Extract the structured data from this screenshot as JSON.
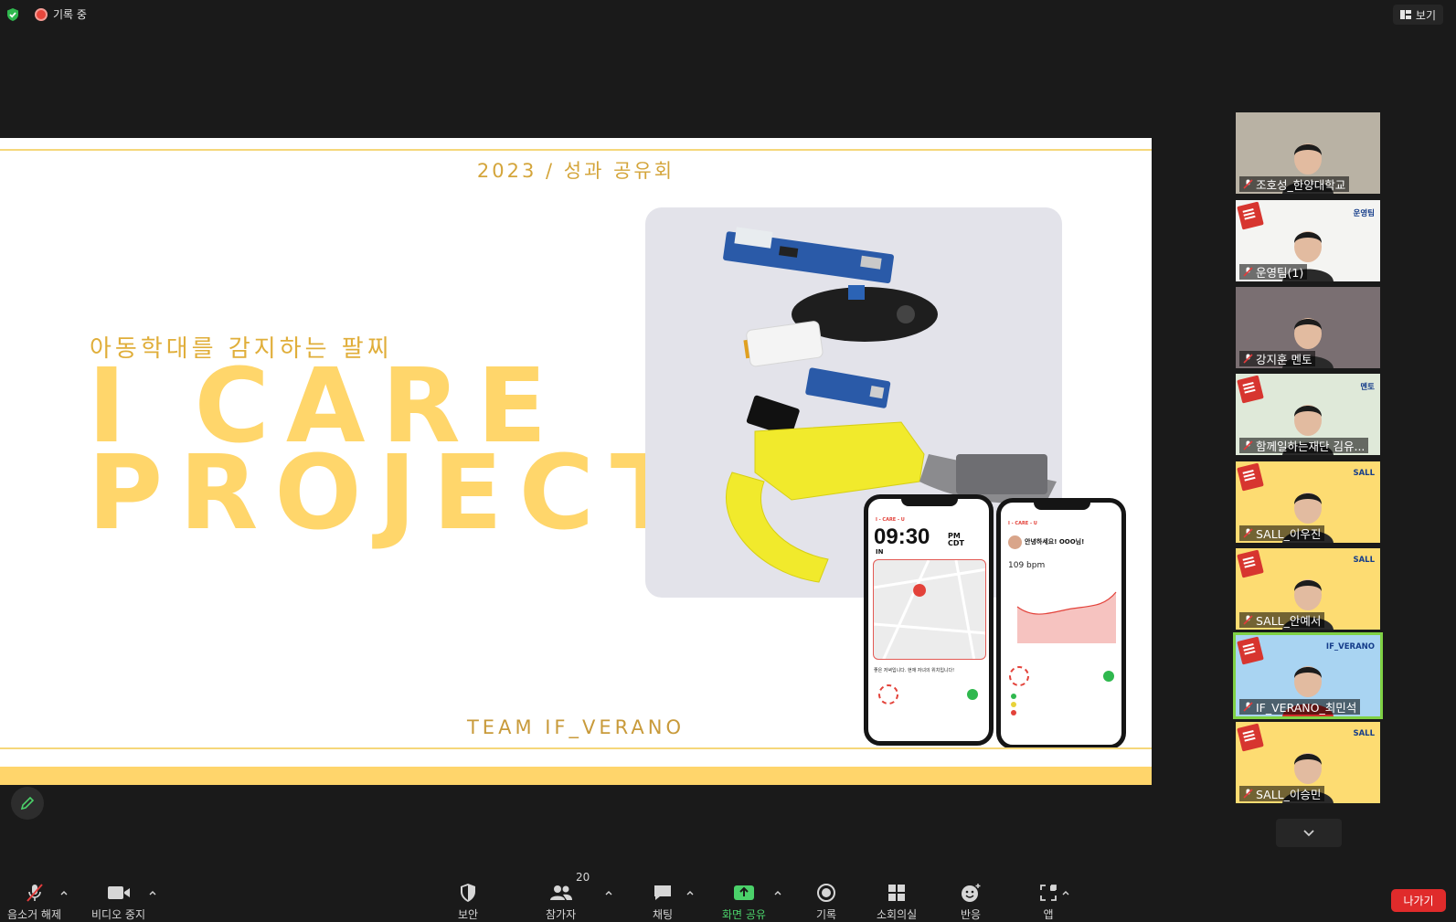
{
  "top_bar": {
    "recording_label": "기록 중",
    "view_label": "보기"
  },
  "slide": {
    "header": "2023 / 성과 공유회",
    "subtitle": "아동학대를 감지하는 팔찌",
    "title_line1": "I CARE",
    "title_line2": "PROJECT",
    "team": "TEAM IF_VERANO",
    "phone1": {
      "brand": "I - CARE - U",
      "time": "09:30",
      "ampm_top": "PM",
      "ampm_bottom": "CDT",
      "in_label": "IN",
      "message": "좋은 저녁입니다. 현재 자녀의 위치입니다!"
    },
    "phone2": {
      "brand": "I - CARE - U",
      "greeting": "안녕하세요! OOO님!",
      "bpm": "109 bpm"
    }
  },
  "participants": [
    {
      "name": "조호성_한양대학교",
      "tag": "",
      "bg": "#b9b2a4"
    },
    {
      "name": "운영팀(1)",
      "tag": "운영팀",
      "bg": "#f4f4f2"
    },
    {
      "name": "강지훈 멘토",
      "tag": "",
      "bg": "#7a6f72"
    },
    {
      "name": "함께일하는재단 김유...",
      "tag": "멘토",
      "bg": "#dfe9d9"
    },
    {
      "name": "SALL_이우진",
      "tag": "SALL",
      "bg": "#fddc72"
    },
    {
      "name": "SALL_안예서",
      "tag": "SALL",
      "bg": "#fddc72"
    },
    {
      "name": "IF_VERANO_최민석",
      "tag": "IF_VERANO",
      "bg": "#a9d4f2"
    },
    {
      "name": "SALL_이승민",
      "tag": "SALL",
      "bg": "#fddc72"
    }
  ],
  "toolbar": {
    "unmute": "음소거 해제",
    "stop_video": "비디오 중지",
    "security": "보안",
    "participants": "참가자",
    "participants_count": "20",
    "chat": "채팅",
    "share_screen": "화면 공유",
    "record": "기록",
    "breakout": "소회의실",
    "reactions": "반응",
    "apps": "앱",
    "leave": "나가기"
  },
  "colors": {
    "accent_yellow": "#ffd66b",
    "share_green": "#4bd16a",
    "leave_red": "#e02b2b"
  }
}
